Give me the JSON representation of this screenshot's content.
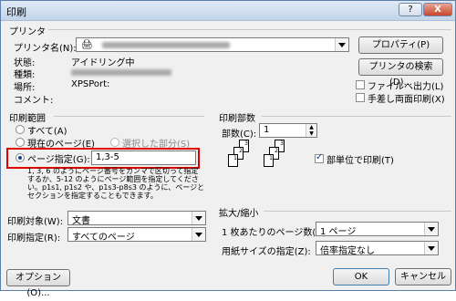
{
  "window": {
    "title": "印刷",
    "help_label": "?",
    "close_label": "X"
  },
  "printer": {
    "group_label": "プリンタ",
    "name_label": "プリンタ名(N):",
    "status_label": "状態:",
    "status_value": "アイドリング中",
    "type_label": "種類:",
    "location_label": "場所:",
    "location_value": "XPSPort:",
    "comment_label": "コメント:",
    "properties_button": "プロパティ(P)",
    "find_button": "プリンタの検索(D)...",
    "print_to_file_label": "ファイルへ出力(L)",
    "manual_duplex_label": "手差し両面印刷(X)"
  },
  "page_range": {
    "group_label": "印刷範囲",
    "all_label": "すべて(A)",
    "current_label": "現在のページ(E)",
    "selection_label": "選択した部分(S)",
    "pages_label": "ページ指定(G):",
    "pages_value": "1,3-5",
    "help_text": "1, 3, 6 のようにページ番号をカンマで区切って指定するか、5-12 のようにページ範囲を指定してください。p1s1, p1s2 や、p1s3-p8s3 のように、ページとセクションを指定することもできます。"
  },
  "copies": {
    "group_label": "印刷部数",
    "count_label": "部数(C):",
    "count_value": "1",
    "collate_label": "部単位で印刷(T)",
    "page_numbers": [
      "1",
      "2",
      "3"
    ]
  },
  "print_what": {
    "label": "印刷対象(W):",
    "value": "文書"
  },
  "print_select": {
    "label": "印刷指定(R):",
    "value": "すべてのページ"
  },
  "zoom": {
    "group_label": "拡大/縮小",
    "pages_per_sheet_label": "1 枚あたりのページ数(H):",
    "pages_per_sheet_value": "1 ページ",
    "scale_label": "用紙サイズの指定(Z):",
    "scale_value": "倍率指定なし"
  },
  "footer": {
    "options_button": "オプション(O)...",
    "ok_button": "OK",
    "cancel_button": "キャンセル"
  }
}
